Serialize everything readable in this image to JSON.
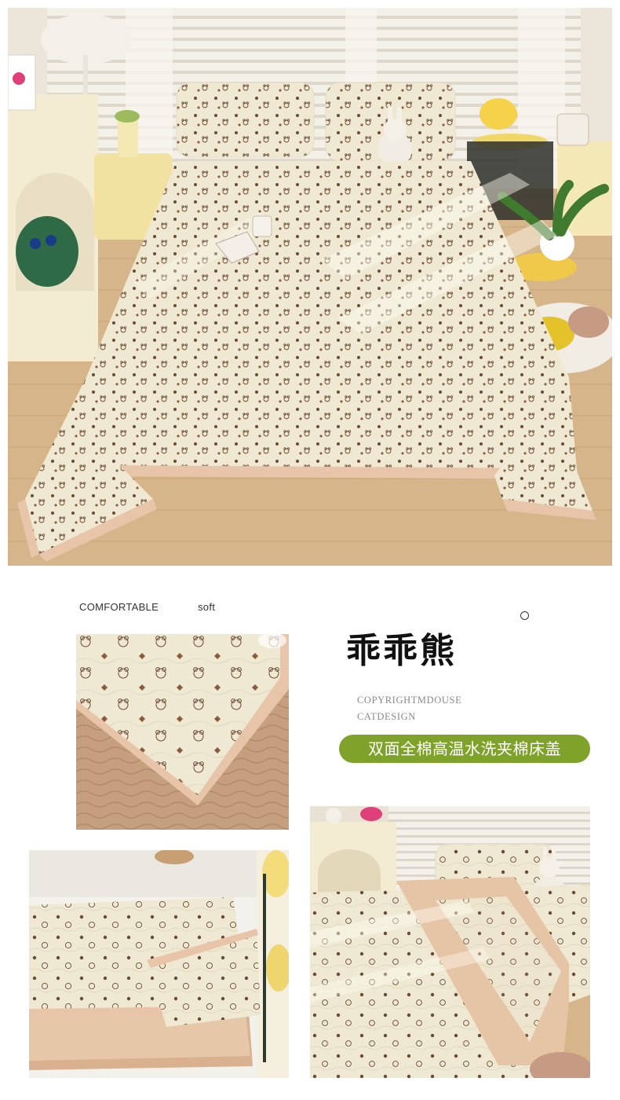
{
  "labels": {
    "comfortable": "COMFORTABLE",
    "soft": "soft"
  },
  "title": "乖乖熊",
  "copyright": {
    "line1": "COPYRIGHTMDOUSE",
    "line2": "CATDESIGN"
  },
  "banner": "双面全棉高温水洗夹棉床盖",
  "colors": {
    "banner_green": "#7fa32a",
    "fabric_cream": "#efe9d3",
    "trim_pink": "#e8c4a8",
    "print_brown": "#6b4a33"
  }
}
